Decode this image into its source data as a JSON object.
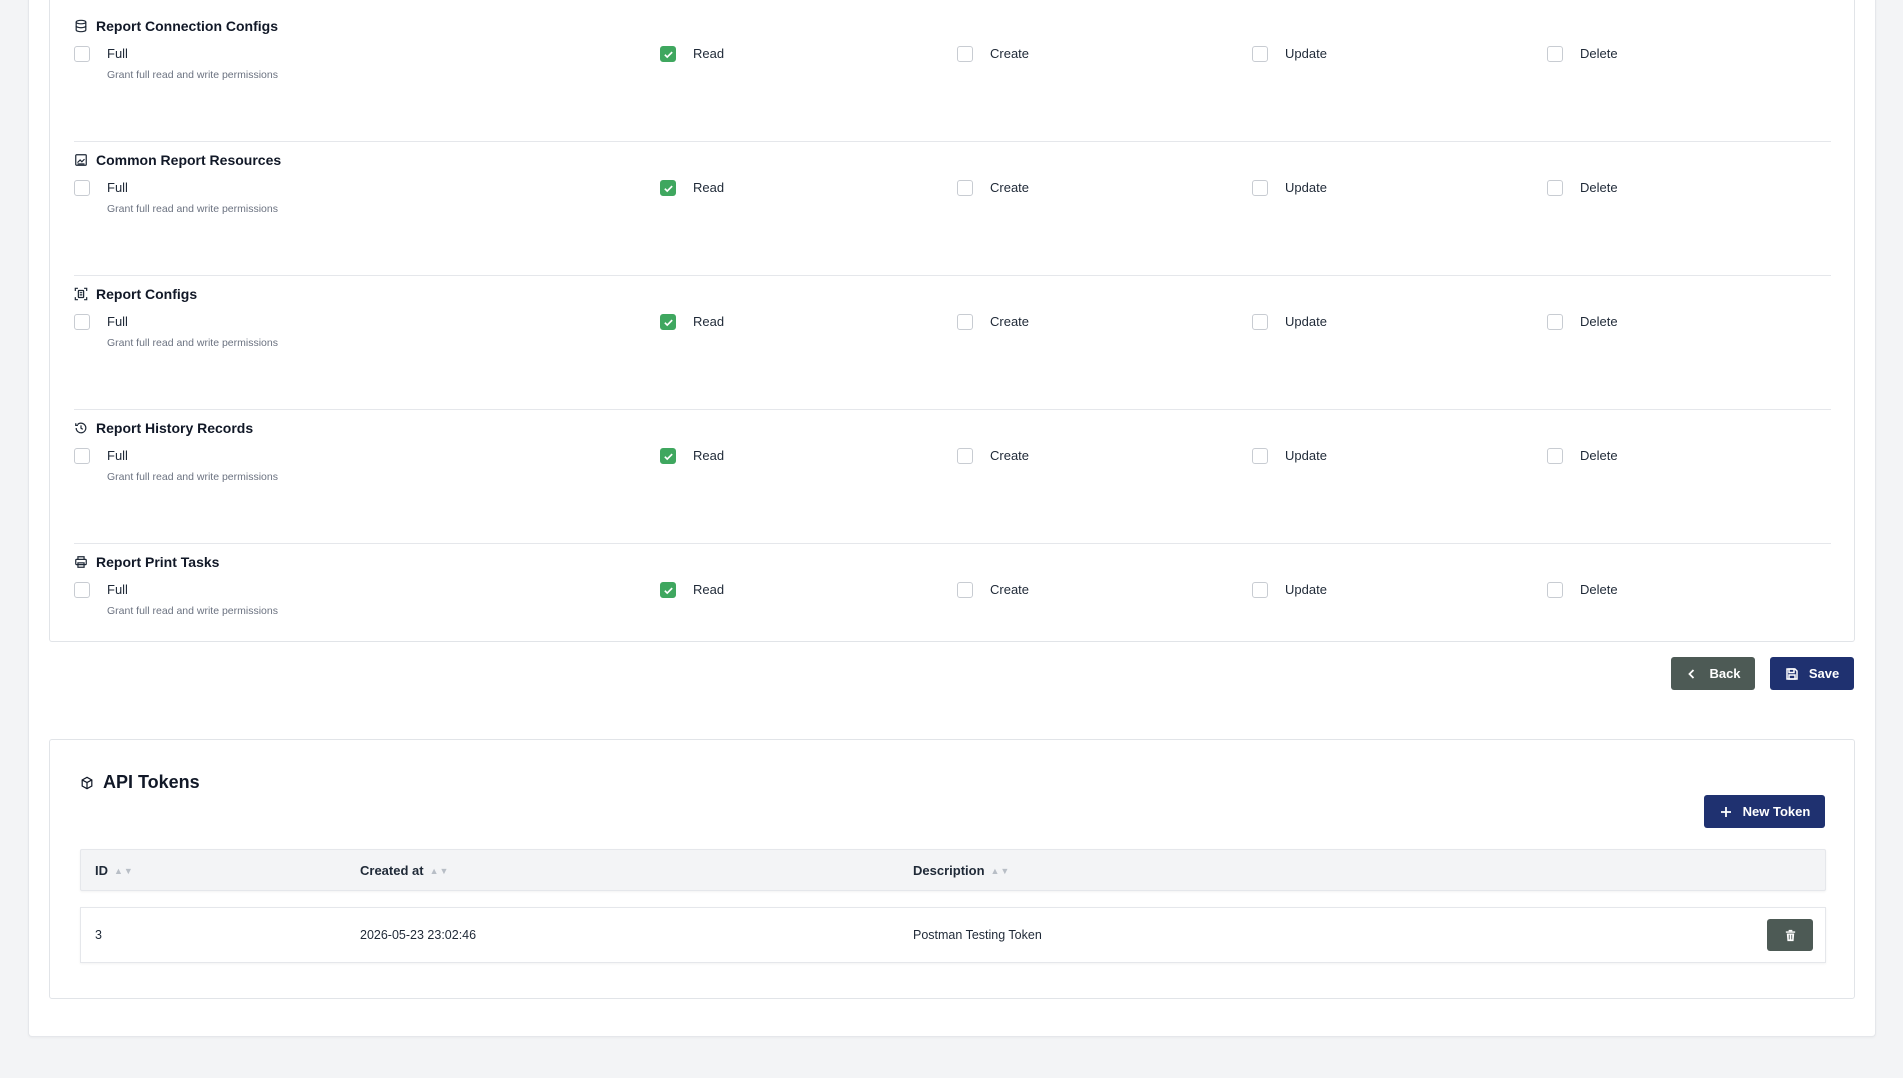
{
  "permission_labels": {
    "full": "Full",
    "full_desc": "Grant full read and write permissions",
    "read": "Read",
    "create": "Create",
    "update": "Update",
    "delete": "Delete"
  },
  "sections": [
    {
      "title": "Report Connection Configs",
      "icon": "database-icon",
      "full": false,
      "read": true,
      "create": false,
      "update": false,
      "delete": false
    },
    {
      "title": "Common Report Resources",
      "icon": "image-icon",
      "full": false,
      "read": true,
      "create": false,
      "update": false,
      "delete": false
    },
    {
      "title": "Report Configs",
      "icon": "frame-icon",
      "full": false,
      "read": true,
      "create": false,
      "update": false,
      "delete": false
    },
    {
      "title": "Report History Records",
      "icon": "history-icon",
      "full": false,
      "read": true,
      "create": false,
      "update": false,
      "delete": false
    },
    {
      "title": "Report Print Tasks",
      "icon": "printer-icon",
      "full": false,
      "read": true,
      "create": false,
      "update": false,
      "delete": false
    }
  ],
  "actions": {
    "back_label": "Back",
    "save_label": "Save"
  },
  "tokens": {
    "title": "API Tokens",
    "new_label": "New Token",
    "columns": [
      "ID",
      "Created at",
      "Description"
    ],
    "sort_glyph": "▲▼",
    "rows": [
      {
        "id": "3",
        "created_at": "2026-05-23 23:02:46",
        "description": "Postman Testing Token"
      }
    ]
  },
  "colors": {
    "primary": "#1f3170",
    "secondary": "#4d5a55",
    "check": "#3fa75f"
  }
}
